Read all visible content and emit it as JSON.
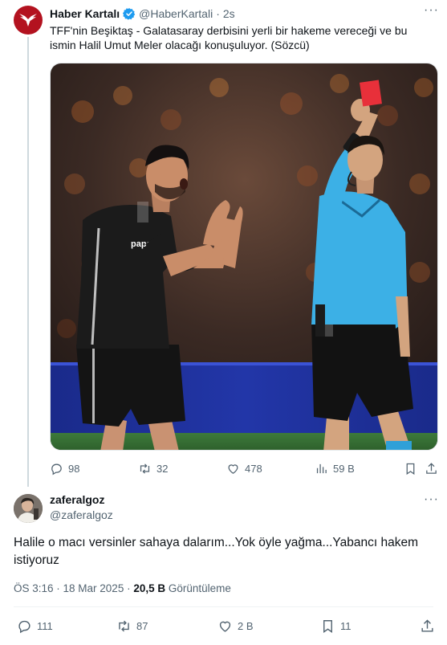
{
  "tweet": {
    "author_name": "Haber Kartalı",
    "handle": "@HaberKartali",
    "time": "2s",
    "text": "TFF'nin Beşiktaş - Galatasaray derbisini yerli bir hakeme vereceği ve bu ismin Halil Umut Meler olacağı konuşuluyor. (Sözcü)",
    "media_text": "papara",
    "stats": {
      "replies": "98",
      "retweets": "32",
      "likes": "478",
      "views": "59 B"
    }
  },
  "reply": {
    "author_name": "zaferalgoz",
    "handle": "@zaferalgoz",
    "text": "Halile o macı versinler sahaya dalarım...Yok öyle yağma...Yabancı hakem istiyoruz",
    "time": "ÖS 3:16 · 18 Mar 2025 ·",
    "views_count": "20,5 B",
    "views_label": "Görüntüleme",
    "stats": {
      "replies": "111",
      "retweets": "87",
      "likes": "2 B",
      "bookmarks": "11"
    }
  },
  "colors": {
    "accent": "#1d9bf0",
    "muted": "#536471",
    "text": "#0f1419",
    "brand": "#b3121f"
  }
}
